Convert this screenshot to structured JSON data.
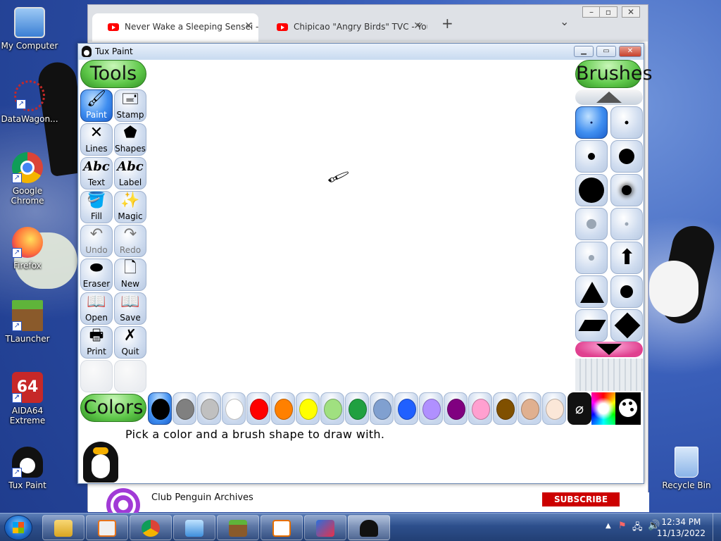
{
  "desktop": {
    "icons": [
      {
        "label": "My Computer",
        "color": "#3b7fd4"
      },
      {
        "label": "DataWagon...",
        "color": "#c62828"
      },
      {
        "label": "Google Chrome",
        "color": "#1a73e8"
      },
      {
        "label": "Firefox",
        "color": "#ff7139"
      },
      {
        "label": "TLauncher",
        "color": "#5a8f2e"
      },
      {
        "label": "AIDA64 Extreme",
        "color": "#c62828"
      },
      {
        "label": "Tux Paint",
        "color": "#111111"
      },
      {
        "label": "Recycle Bin",
        "color": "#8ab4e8"
      }
    ]
  },
  "browser": {
    "tabs": [
      {
        "title": "Never Wake a Sleeping Sensei - ..."
      },
      {
        "title": "Chipicao \"Angry Birds\" TVC - You..."
      }
    ],
    "new_tab": "+",
    "dropdown": "⌄",
    "channel": "Club Penguin Archives",
    "subscribe": "SUBSCRIBE"
  },
  "tuxpaint": {
    "window_title": "Tux Paint",
    "tools_title": "Tools",
    "brushes_title": "Brushes",
    "colors_title": "Colors",
    "tools": [
      {
        "label": "Paint",
        "icon": "🖌",
        "selected": true
      },
      {
        "label": "Stamp",
        "icon": "🖃"
      },
      {
        "label": "Lines",
        "icon": "✕"
      },
      {
        "label": "Shapes",
        "icon": "⬟"
      },
      {
        "label": "Text",
        "icon": "Abc"
      },
      {
        "label": "Label",
        "icon": "Abc"
      },
      {
        "label": "Fill",
        "icon": "🪣"
      },
      {
        "label": "Magic",
        "icon": "✨"
      },
      {
        "label": "Undo",
        "icon": "↶",
        "disabled": true
      },
      {
        "label": "Redo",
        "icon": "↷",
        "disabled": true
      },
      {
        "label": "Eraser",
        "icon": "⬬"
      },
      {
        "label": "New",
        "icon": "🗋"
      },
      {
        "label": "Open",
        "icon": "📖"
      },
      {
        "label": "Save",
        "icon": "📖"
      },
      {
        "label": "Print",
        "icon": "🖶"
      },
      {
        "label": "Quit",
        "icon": "✗"
      }
    ],
    "colors": [
      "#000000",
      "#808080",
      "#c0c0c0",
      "#ffffff",
      "#ff0000",
      "#ff8000",
      "#ffff00",
      "#a0e080",
      "#20a040",
      "#80a0d0",
      "#2060ff",
      "#b090ff",
      "#800080",
      "#ffa0d0",
      "#805000",
      "#e0b090",
      "#fbe7d8"
    ],
    "status_message": "Pick a color and a brush shape to draw with."
  },
  "taskbar": {
    "time": "12:34 PM",
    "date": "11/13/2022"
  }
}
